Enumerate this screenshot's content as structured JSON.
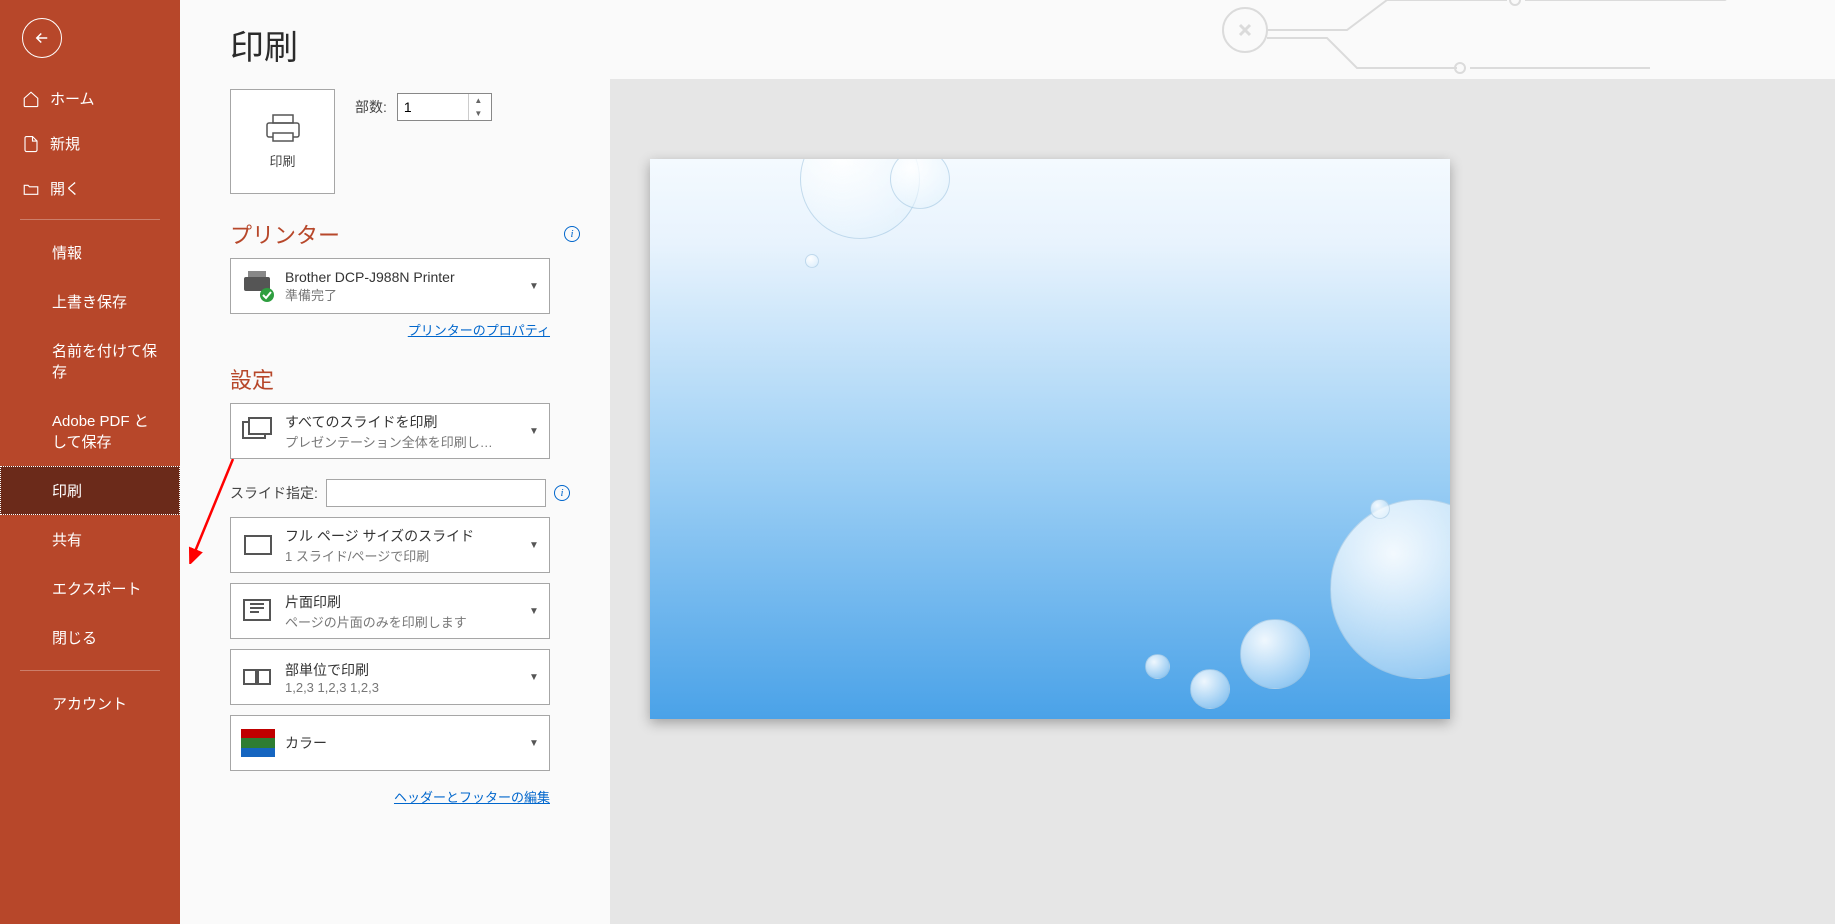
{
  "page_title": "印刷",
  "sidebar": {
    "items": [
      {
        "label": "ホーム"
      },
      {
        "label": "新規"
      },
      {
        "label": "開く"
      }
    ],
    "sub_items": [
      {
        "label": "情報"
      },
      {
        "label": "上書き保存"
      },
      {
        "label": "名前を付けて保存"
      },
      {
        "label": "Adobe PDF として保存"
      },
      {
        "label": "印刷"
      },
      {
        "label": "共有"
      },
      {
        "label": "エクスポート"
      },
      {
        "label": "閉じる"
      }
    ],
    "bottom_items": [
      {
        "label": "アカウント"
      }
    ]
  },
  "print": {
    "button_label": "印刷",
    "copies_label": "部数:",
    "copies_value": "1"
  },
  "printer_section": {
    "title": "プリンター",
    "name": "Brother DCP-J988N Printer",
    "status": "準備完了",
    "properties_link": "プリンターのプロパティ"
  },
  "settings_section": {
    "title": "設定",
    "slide_range": {
      "title": "すべてのスライドを印刷",
      "sub": "プレゼンテーション全体を印刷し…"
    },
    "slide_spec_label": "スライド指定:",
    "slide_spec_value": "",
    "layout": {
      "title": "フル ページ サイズのスライド",
      "sub": "1 スライド/ページで印刷"
    },
    "sides": {
      "title": "片面印刷",
      "sub": "ページの片面のみを印刷します"
    },
    "collate": {
      "title": "部単位で印刷",
      "sub": "1,2,3   1,2,3   1,2,3"
    },
    "color": {
      "title": "カラー"
    },
    "header_footer_link": "ヘッダーとフッターの編集"
  }
}
